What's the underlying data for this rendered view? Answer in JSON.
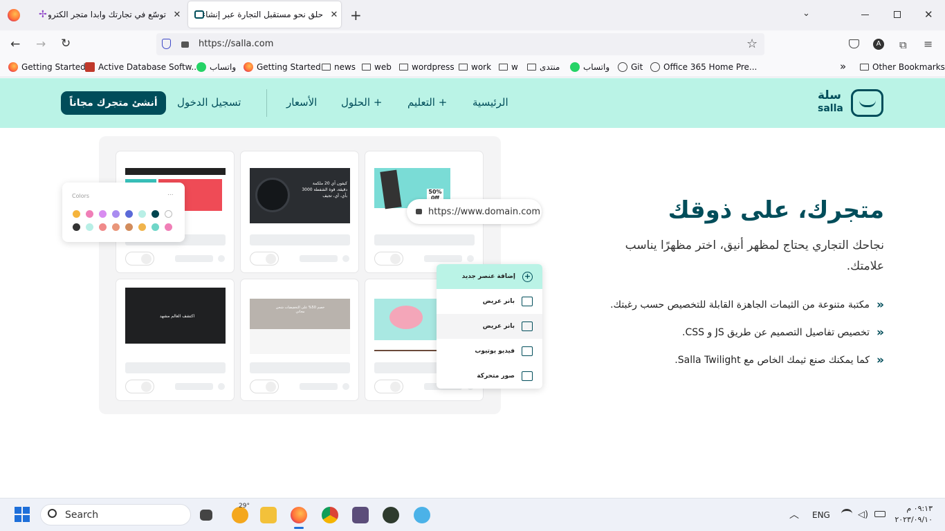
{
  "browser": {
    "tabs": [
      {
        "title": "توسّع في تجارتك وابدا متجر الكترو",
        "active": false
      },
      {
        "title": "حلق نحو مستقبل التجارة عبر إنشاء",
        "active": true
      }
    ],
    "new_tab": "+",
    "url": "https://salla.com",
    "avatar_letter": "A",
    "bookmarks": [
      {
        "label": "Getting Started",
        "icon": "firefox-icon"
      },
      {
        "label": "Active Database Softw...",
        "icon": "database-icon"
      },
      {
        "label": "واتساب",
        "icon": "whatsapp-icon"
      },
      {
        "label": "Getting Started",
        "icon": "firefox-icon"
      },
      {
        "label": "news",
        "icon": "folder-icon"
      },
      {
        "label": "web",
        "icon": "folder-icon"
      },
      {
        "label": "wordpress",
        "icon": "folder-icon"
      },
      {
        "label": "work",
        "icon": "folder-icon"
      },
      {
        "label": "w",
        "icon": "folder-icon"
      },
      {
        "label": "منتدى",
        "icon": "folder-icon"
      },
      {
        "label": "واتساب",
        "icon": "whatsapp-icon"
      },
      {
        "label": "Git",
        "icon": "globe-icon"
      },
      {
        "label": "Office 365 Home Pre...",
        "icon": "globe-icon"
      }
    ],
    "overflow": "»",
    "other_bookmarks": "Other Bookmarks"
  },
  "site": {
    "logo_ar": "سلة",
    "logo_en": "salla",
    "nav": {
      "home": "الرئيسية",
      "learning": "التعليم +",
      "solutions": "الحلول +",
      "pricing": "الأسعار",
      "login": "تسجيل الدخول",
      "cta": "أنشئ متجرك مجاناً"
    },
    "hero": {
      "title": "متجرك، على ذوقك",
      "subtitle": "نجاحك التجاري يحتاج لمظهر أنيق، اختر مظهرًا يناسب علامتك.",
      "features": [
        "مكتبة متنوعة من الثيمات الجاهزة القابلة للتخصيص حسب رغبتك.",
        "تخصيص تفاصيل التصميم عن طريق JS و CSS.",
        "كما يمكنك صنع ثيمك الخاص مع Salla Twilight."
      ],
      "bullet": "«"
    },
    "mockup": {
      "colors_title": "Colors",
      "colors_menu": "...",
      "domain": "https://www.domain.com",
      "panel": [
        "إضافة عنصر جديد",
        "بانر عريض",
        "بانر عريض",
        "فيديو يوتيوب",
        "صور متحركة"
      ],
      "swatch_colors": [
        "#f5b43c",
        "#f07fb7",
        "#d88cf0",
        "#a98cf0",
        "#5b6ad8",
        "#b8efe6",
        "#00454f",
        "#ffffff",
        "#333333",
        "#b8efe6",
        "#f08a8a",
        "#e9967a",
        "#d28c5c",
        "#f0b44c",
        "#6fd6c8",
        "#f07fb7"
      ],
      "thumb1_text": "كيفون آي 20 ملكمة دقيقة، قوة الشفطة 3000 بأي، أي، تجيف",
      "thumb2_text": "خصم 50% على التخفيضات شحن مجاني",
      "thumb3_text": "اكتشف العالم مشهد",
      "thumb4_text": "50% 0ff"
    }
  },
  "taskbar": {
    "search": "Search",
    "weather": "29°",
    "lang": "ENG",
    "time": "٠٩:١٣ م",
    "date": "٢٠٢٣/٠٩/١٠"
  }
}
